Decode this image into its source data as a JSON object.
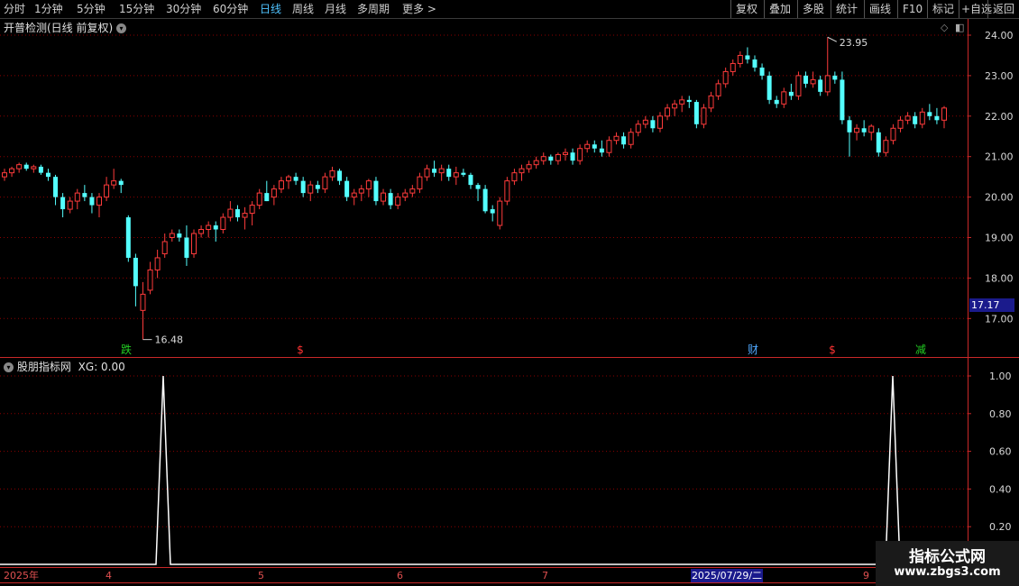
{
  "toolbar": {
    "periods": [
      "分时",
      "1分钟",
      "5分钟",
      "15分钟",
      "30分钟",
      "60分钟",
      "日线",
      "周线",
      "月线",
      "多周期",
      "更多 >"
    ],
    "active_period": "日线",
    "actions": [
      "复权",
      "叠加",
      "多股",
      "统计",
      "画线",
      "F10",
      "标记",
      "+自选",
      "返回"
    ]
  },
  "main_chart": {
    "title": "开普检测(日线 前复权)",
    "high_label": "23.95",
    "low_label": "16.48",
    "current_price": "17.17",
    "price_axis": [
      "24.00",
      "23.00",
      "22.00",
      "21.00",
      "20.00",
      "19.00",
      "18.00",
      "17.00"
    ],
    "events": [
      {
        "label": "跌",
        "color": "#22cc22"
      },
      {
        "label": "$",
        "color": "#ff3333"
      },
      {
        "label": "财",
        "color": "#4fa8ff"
      },
      {
        "label": "$",
        "color": "#ff3333"
      },
      {
        "label": "减",
        "color": "#22cc22"
      }
    ]
  },
  "indicator_chart": {
    "title": "股朋指标网",
    "series_label": "XG: 0.00",
    "axis": [
      "1.00",
      "0.80",
      "0.60",
      "0.40",
      "0.20"
    ]
  },
  "date_axis": {
    "labels": [
      "2025年",
      "4",
      "5",
      "6",
      "7",
      "9"
    ],
    "highlight": "2025/07/29/二"
  },
  "watermark": {
    "title": "指标公式网",
    "url": "www.zbgs3.com"
  },
  "colors": {
    "up": "#ff3b3b",
    "down": "#54ffff",
    "grid": "#8b0000",
    "axis": "#c82828"
  },
  "chart_data": {
    "type": "candlestick",
    "price_range": [
      16.0,
      24.3
    ],
    "ohlc": [
      [
        20.5,
        20.7,
        20.4,
        20.6
      ],
      [
        20.6,
        20.75,
        20.5,
        20.7
      ],
      [
        20.7,
        20.85,
        20.6,
        20.8
      ],
      [
        20.8,
        20.85,
        20.65,
        20.7
      ],
      [
        20.7,
        20.8,
        20.6,
        20.75
      ],
      [
        20.75,
        20.8,
        20.55,
        20.6
      ],
      [
        20.6,
        20.7,
        20.4,
        20.5
      ],
      [
        20.5,
        20.55,
        19.8,
        20.0
      ],
      [
        20.0,
        20.1,
        19.5,
        19.7
      ],
      [
        19.7,
        20.0,
        19.6,
        19.9
      ],
      [
        19.9,
        20.2,
        19.7,
        20.1
      ],
      [
        20.1,
        20.3,
        19.9,
        20.0
      ],
      [
        20.0,
        20.1,
        19.6,
        19.8
      ],
      [
        19.8,
        20.1,
        19.5,
        20.0
      ],
      [
        20.0,
        20.5,
        19.9,
        20.3
      ],
      [
        20.3,
        20.7,
        20.2,
        20.4
      ],
      [
        20.4,
        20.45,
        20.1,
        20.3
      ],
      [
        19.5,
        19.55,
        18.4,
        18.5
      ],
      [
        18.5,
        18.6,
        17.3,
        17.8
      ],
      [
        17.2,
        17.9,
        16.48,
        17.6
      ],
      [
        17.7,
        18.4,
        17.6,
        18.2
      ],
      [
        18.2,
        18.7,
        18.0,
        18.5
      ],
      [
        18.6,
        19.1,
        18.5,
        18.9
      ],
      [
        19.0,
        19.2,
        18.9,
        19.1
      ],
      [
        19.1,
        19.2,
        18.9,
        19.0
      ],
      [
        19.0,
        19.3,
        18.3,
        18.5
      ],
      [
        18.6,
        19.2,
        18.5,
        19.1
      ],
      [
        19.1,
        19.3,
        19.0,
        19.2
      ],
      [
        19.2,
        19.4,
        19.0,
        19.3
      ],
      [
        19.3,
        19.4,
        18.9,
        19.2
      ],
      [
        19.2,
        19.6,
        19.1,
        19.5
      ],
      [
        19.5,
        19.9,
        19.4,
        19.7
      ],
      [
        19.7,
        19.8,
        19.4,
        19.5
      ],
      [
        19.5,
        19.75,
        19.2,
        19.6
      ],
      [
        19.6,
        19.9,
        19.3,
        19.8
      ],
      [
        19.8,
        20.2,
        19.7,
        20.1
      ],
      [
        20.1,
        20.4,
        19.9,
        19.9
      ],
      [
        20.0,
        20.3,
        19.8,
        20.2
      ],
      [
        20.2,
        20.5,
        20.1,
        20.4
      ],
      [
        20.4,
        20.55,
        20.2,
        20.5
      ],
      [
        20.5,
        20.6,
        20.3,
        20.4
      ],
      [
        20.4,
        20.5,
        20.0,
        20.1
      ],
      [
        20.1,
        20.4,
        19.9,
        20.3
      ],
      [
        20.3,
        20.4,
        20.1,
        20.2
      ],
      [
        20.2,
        20.6,
        20.1,
        20.5
      ],
      [
        20.5,
        20.75,
        20.4,
        20.65
      ],
      [
        20.65,
        20.7,
        20.3,
        20.4
      ],
      [
        20.4,
        20.5,
        19.9,
        20.0
      ],
      [
        20.0,
        20.2,
        19.8,
        20.1
      ],
      [
        20.1,
        20.3,
        19.9,
        20.2
      ],
      [
        20.2,
        20.45,
        20.0,
        20.4
      ],
      [
        20.4,
        20.5,
        19.8,
        19.9
      ],
      [
        19.9,
        20.2,
        19.8,
        20.1
      ],
      [
        20.1,
        20.2,
        19.7,
        19.8
      ],
      [
        19.8,
        20.1,
        19.7,
        20.0
      ],
      [
        20.0,
        20.2,
        19.9,
        20.1
      ],
      [
        20.1,
        20.3,
        20.0,
        20.2
      ],
      [
        20.2,
        20.6,
        20.1,
        20.5
      ],
      [
        20.5,
        20.8,
        20.4,
        20.7
      ],
      [
        20.7,
        20.9,
        20.5,
        20.6
      ],
      [
        20.6,
        20.8,
        20.4,
        20.7
      ],
      [
        20.7,
        20.8,
        20.4,
        20.5
      ],
      [
        20.5,
        20.75,
        20.3,
        20.6
      ],
      [
        20.6,
        20.7,
        20.5,
        20.55
      ],
      [
        20.55,
        20.6,
        20.2,
        20.3
      ],
      [
        20.3,
        20.35,
        19.9,
        20.2
      ],
      [
        20.2,
        20.3,
        19.6,
        19.65
      ],
      [
        19.7,
        19.8,
        19.4,
        19.6
      ],
      [
        19.3,
        20.0,
        19.2,
        19.9
      ],
      [
        19.9,
        20.5,
        19.8,
        20.4
      ],
      [
        20.4,
        20.7,
        20.3,
        20.6
      ],
      [
        20.6,
        20.8,
        20.4,
        20.7
      ],
      [
        20.7,
        20.9,
        20.6,
        20.8
      ],
      [
        20.8,
        21.0,
        20.7,
        20.9
      ],
      [
        20.9,
        21.1,
        20.8,
        21.0
      ],
      [
        21.0,
        21.05,
        20.8,
        20.9
      ],
      [
        20.9,
        21.1,
        20.8,
        21.05
      ],
      [
        21.05,
        21.2,
        20.9,
        21.1
      ],
      [
        21.1,
        21.2,
        20.8,
        20.9
      ],
      [
        20.9,
        21.3,
        20.8,
        21.2
      ],
      [
        21.2,
        21.4,
        21.1,
        21.3
      ],
      [
        21.3,
        21.4,
        21.1,
        21.2
      ],
      [
        21.2,
        21.4,
        21.0,
        21.1
      ],
      [
        21.1,
        21.5,
        21.0,
        21.4
      ],
      [
        21.4,
        21.6,
        21.3,
        21.5
      ],
      [
        21.5,
        21.6,
        21.2,
        21.3
      ],
      [
        21.3,
        21.7,
        21.2,
        21.6
      ],
      [
        21.6,
        21.9,
        21.5,
        21.8
      ],
      [
        21.8,
        22.0,
        21.7,
        21.9
      ],
      [
        21.9,
        22.0,
        21.6,
        21.7
      ],
      [
        21.7,
        22.1,
        21.6,
        22.0
      ],
      [
        22.0,
        22.3,
        21.9,
        22.2
      ],
      [
        22.2,
        22.4,
        22.0,
        22.3
      ],
      [
        22.3,
        22.5,
        22.1,
        22.4
      ],
      [
        22.4,
        22.5,
        22.2,
        22.35
      ],
      [
        22.35,
        22.4,
        21.7,
        21.8
      ],
      [
        21.8,
        22.3,
        21.7,
        22.2
      ],
      [
        22.2,
        22.6,
        22.1,
        22.5
      ],
      [
        22.5,
        22.9,
        22.4,
        22.8
      ],
      [
        22.8,
        23.2,
        22.7,
        23.1
      ],
      [
        23.1,
        23.4,
        23.0,
        23.3
      ],
      [
        23.3,
        23.6,
        23.2,
        23.5
      ],
      [
        23.5,
        23.7,
        23.3,
        23.4
      ],
      [
        23.4,
        23.5,
        23.1,
        23.2
      ],
      [
        23.2,
        23.3,
        22.9,
        23.0
      ],
      [
        23.0,
        23.1,
        22.3,
        22.4
      ],
      [
        22.4,
        22.5,
        22.2,
        22.3
      ],
      [
        22.3,
        22.7,
        22.2,
        22.6
      ],
      [
        22.6,
        22.8,
        22.4,
        22.5
      ],
      [
        22.5,
        23.1,
        22.4,
        23.0
      ],
      [
        23.0,
        23.1,
        22.7,
        22.8
      ],
      [
        22.8,
        23.1,
        22.7,
        22.9
      ],
      [
        22.9,
        23.0,
        22.5,
        22.6
      ],
      [
        22.6,
        23.95,
        22.5,
        23.0
      ],
      [
        23.0,
        23.1,
        22.8,
        22.9
      ],
      [
        22.9,
        23.1,
        21.8,
        21.9
      ],
      [
        21.9,
        22.0,
        21.0,
        21.6
      ],
      [
        21.6,
        21.8,
        21.4,
        21.7
      ],
      [
        21.7,
        21.9,
        21.5,
        21.6
      ],
      [
        21.6,
        21.8,
        21.4,
        21.75
      ],
      [
        21.6,
        21.7,
        21.0,
        21.1
      ],
      [
        21.1,
        21.5,
        21.0,
        21.4
      ],
      [
        21.4,
        21.8,
        21.3,
        21.7
      ],
      [
        21.7,
        22.0,
        21.6,
        21.9
      ],
      [
        21.9,
        22.1,
        21.8,
        22.0
      ],
      [
        22.0,
        22.1,
        21.7,
        21.8
      ],
      [
        21.8,
        22.2,
        21.7,
        22.1
      ],
      [
        22.1,
        22.3,
        21.9,
        22.0
      ],
      [
        22.0,
        22.2,
        21.8,
        21.9
      ],
      [
        21.9,
        22.25,
        21.7,
        22.2
      ]
    ],
    "indicator": {
      "name": "XG",
      "range": [
        0,
        1.05
      ],
      "spike_indices": [
        19,
        125
      ],
      "spike_value": 1.0
    }
  }
}
